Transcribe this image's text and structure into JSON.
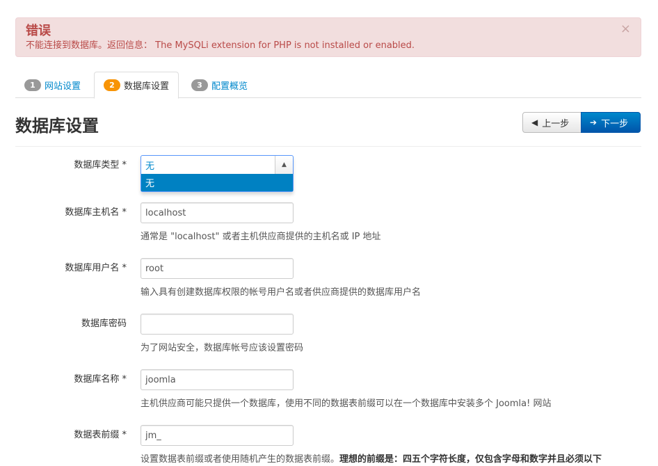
{
  "alert": {
    "title": "错误",
    "message": "不能连接到数据库。返回信息： The MySQLi extension for PHP is not installed or enabled.",
    "close": "×"
  },
  "tabs": [
    {
      "number": "1",
      "label": "网站设置"
    },
    {
      "number": "2",
      "label": "数据库设置"
    },
    {
      "number": "3",
      "label": "配置概览"
    }
  ],
  "header": {
    "title": "数据库设置",
    "prev_label": "上一步",
    "next_label": "下一步"
  },
  "form": {
    "db_type": {
      "label": "数据库类型 *",
      "value": "无",
      "option": "无"
    },
    "db_host": {
      "label": "数据库主机名 *",
      "value": "localhost",
      "help": "通常是 \"localhost\" 或者主机供应商提供的主机名或 IP 地址"
    },
    "db_user": {
      "label": "数据库用户名 *",
      "value": "root",
      "help": "输入具有创建数据库权限的帐号用户名或者供应商提供的数据库用户名"
    },
    "db_pass": {
      "label": "数据库密码",
      "value": "",
      "help": "为了网站安全，数据库帐号应该设置密码"
    },
    "db_name": {
      "label": "数据库名称 *",
      "value": "joomla",
      "help": "主机供应商可能只提供一个数据库，使用不同的数据表前缀可以在一个数据库中安装多个 Joomla! 网站"
    },
    "db_prefix": {
      "label": "数据表前缀 *",
      "value": "jm_",
      "help": "设置数据表前缀或者使用随机产生的数据表前缀。",
      "help_bold": "理想的前缀是：四五个字符长度，仅包含字母和数字并且必须以下"
    }
  },
  "colors": {
    "alert_bg": "#f2dede",
    "alert_text": "#b94a48",
    "link": "#0088cc",
    "primary": "#0088cc",
    "badge_active": "#f89406"
  }
}
